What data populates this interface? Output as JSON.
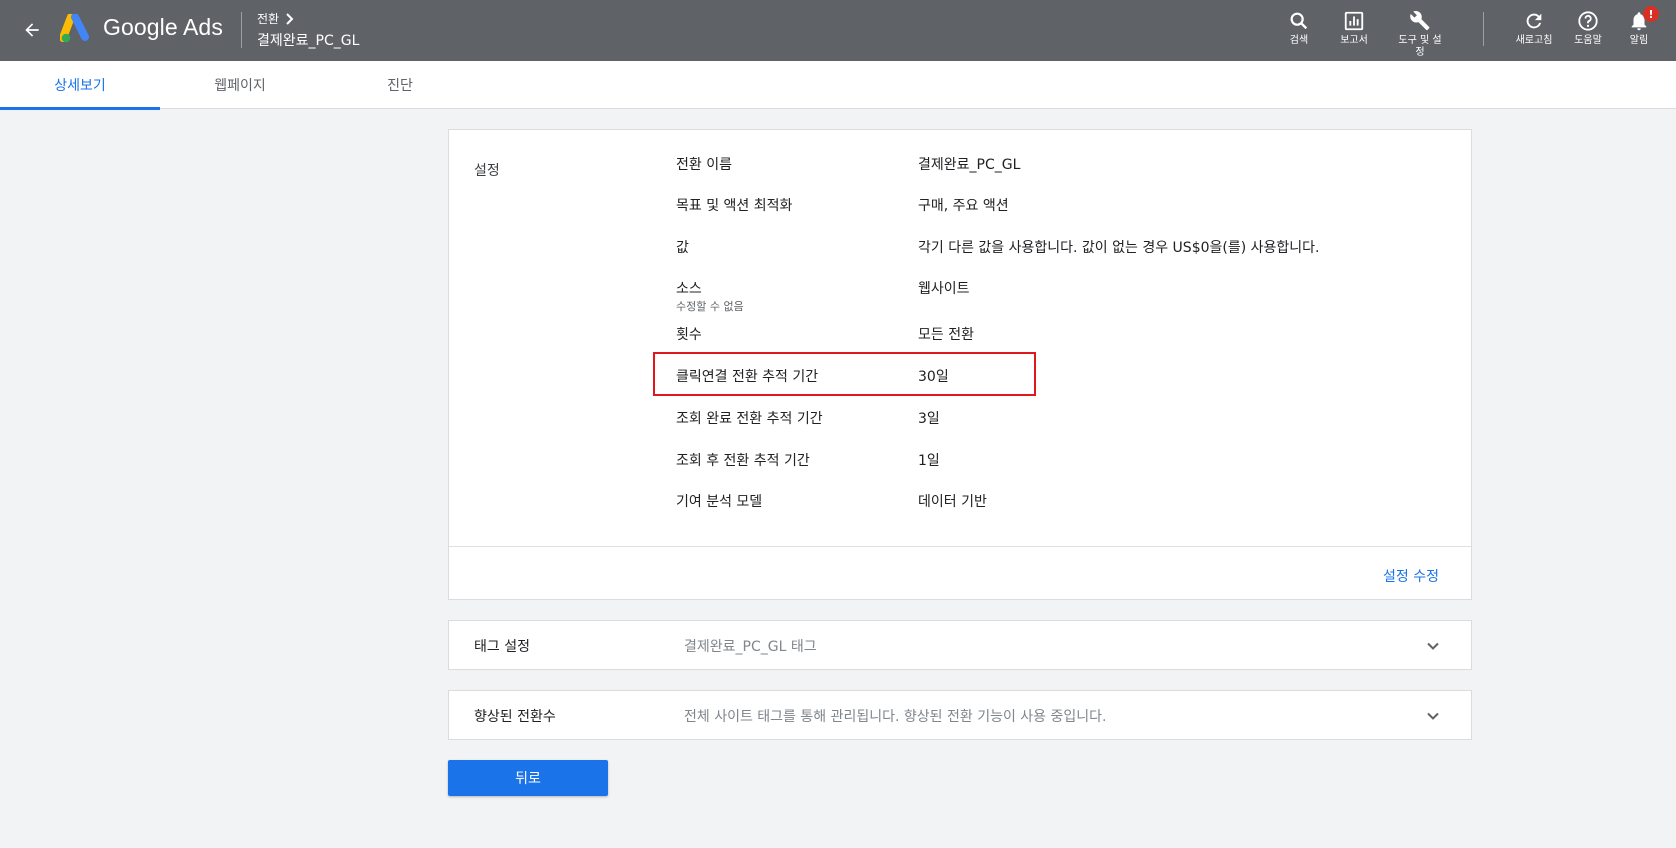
{
  "header": {
    "brand": "Google Ads",
    "breadcrumb_parent": "전환",
    "breadcrumb_current": "결제완료_PC_GL",
    "tools": [
      {
        "label": "검색",
        "icon": "search-icon"
      },
      {
        "label": "보고서",
        "icon": "reports-icon"
      },
      {
        "label": "도구 및 설정",
        "icon": "wrench-icon"
      },
      {
        "label": "새로고침",
        "icon": "refresh-icon"
      },
      {
        "label": "도움말",
        "icon": "help-icon"
      },
      {
        "label": "알림",
        "icon": "bell-icon"
      }
    ],
    "notification_badge": "!"
  },
  "tabs": [
    {
      "label": "상세보기",
      "active": true
    },
    {
      "label": "웹페이지",
      "active": false
    },
    {
      "label": "진단",
      "active": false
    }
  ],
  "settings": {
    "section_label": "설정",
    "rows": [
      {
        "key": "전환 이름",
        "value": "결제완료_PC_GL"
      },
      {
        "key": "목표 및 액션 최적화",
        "value": "구매, 주요 액션"
      },
      {
        "key": "값",
        "value": "각기 다른 값을 사용합니다. 값이 없는 경우 US$0을(를) 사용합니다."
      },
      {
        "key": "소스",
        "sub": "수정할 수 없음",
        "value": "웹사이트"
      },
      {
        "key": "횟수",
        "value": "모든 전환"
      },
      {
        "key": "클릭연결 전환 추적 기간",
        "value": "30일"
      },
      {
        "key": "조회 완료 전환 추적 기간",
        "value": "3일"
      },
      {
        "key": "조회 후 전환 추적 기간",
        "value": "1일"
      },
      {
        "key": "기여 분석 모델",
        "value": "데이터 기반"
      }
    ],
    "edit_link": "설정 수정",
    "highlight_color": "#e0181e"
  },
  "panels": [
    {
      "title": "태그 설정",
      "description": "결제완료_PC_GL 태그"
    },
    {
      "title": "향상된 전환수",
      "description": "전체 사이트 태그를 통해 관리됩니다. 향상된 전환 기능이 사용 중입니다."
    }
  ],
  "back_button": "뒤로",
  "colors": {
    "accent": "#1a73e8",
    "topbar": "#5f6368",
    "background": "#f1f3f4"
  }
}
